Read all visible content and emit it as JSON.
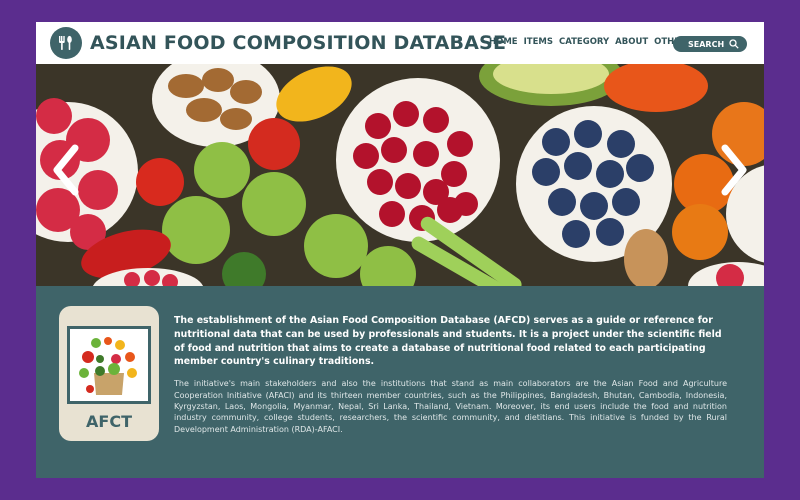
{
  "header": {
    "title": "ASIAN FOOD COMPOSITION DATABASE",
    "logo_icon": "fork-spoon-icon",
    "nav": [
      "HOME",
      "ITEMS",
      "CATEGORY",
      "ABOUT",
      "OTHER"
    ],
    "search_label": "SEARCH",
    "search_icon": "search-icon"
  },
  "hero": {
    "prev_icon": "chevron-left-icon",
    "next_icon": "chevron-right-icon",
    "image_alt": "assorted fruits and vegetables"
  },
  "card": {
    "label": "AFCT"
  },
  "about": {
    "lead": "The establishment of the Asian Food Composition Database (AFCD) serves as a guide or reference for nutritional data that can be used by professionals and students. It is a project under the scientific field of food and nutrition that aims to create a database of nutritional food related to each participating member country's culinary traditions.",
    "body": "The initiative's main stakeholders and also the institutions that stand as main collaborators are the Asian Food and Agriculture Cooperation Initiative (AFACI) and its thirteen member countries, such as the Philippines, Bangladesh, Bhutan, Cambodia, Indonesia, Kyrgyzstan, Laos, Mongolia, Myanmar, Nepal, Sri Lanka, Thailand, Vietnam. Moreover, its end users include the food and nutrition industry community, college students, researchers, the scientific community, and dietitians. This initiative is funded by the Rural Development Administration (RDA)-AFACI."
  },
  "colors": {
    "background": "#5b2d8e",
    "accent": "#3f6469",
    "header": "#ffffff"
  }
}
